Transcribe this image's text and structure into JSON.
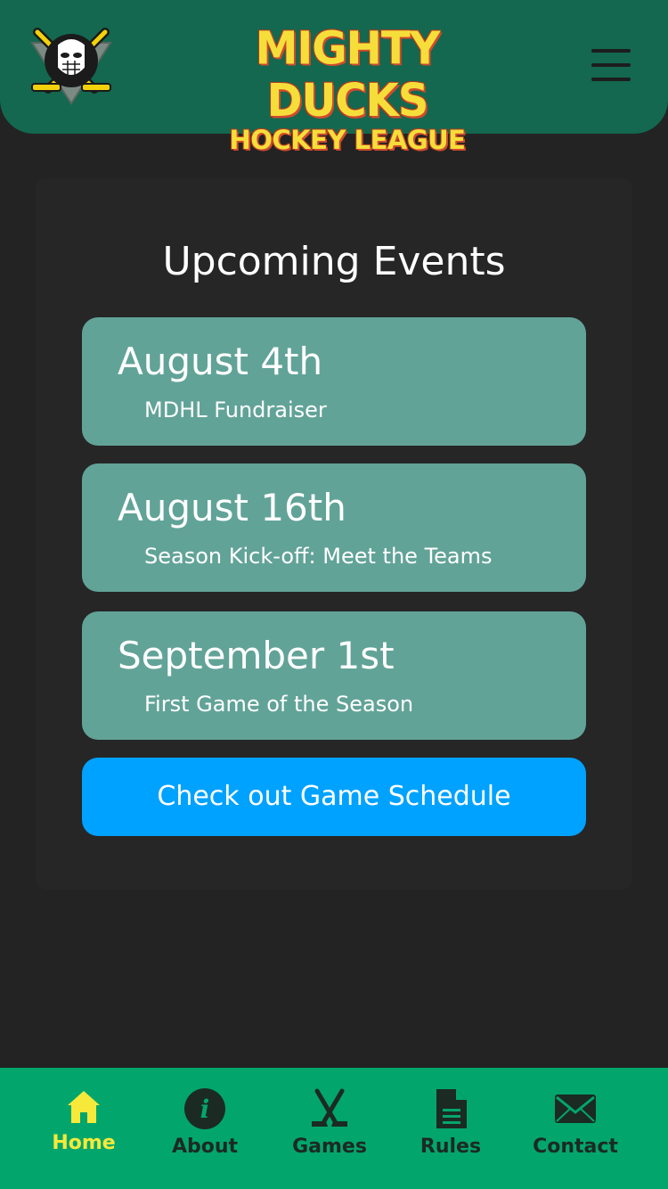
{
  "brand": {
    "line1": "MIGHTY DUCKS",
    "line2": "HOCKEY LEAGUE",
    "logo_icon": "goalie-mask-crossed-sticks-logo",
    "colors": {
      "header_bg": "#13684f",
      "brand_text": "#f6de3a",
      "brand_outline": "#d14a2d"
    }
  },
  "menu": {
    "icon": "hamburger-menu-icon"
  },
  "events_section": {
    "title": "Upcoming Events",
    "events": [
      {
        "date": "August 4th",
        "name": "MDHL Fundraiser"
      },
      {
        "date": "August 16th",
        "name": "Season Kick-off: Meet the Teams"
      },
      {
        "date": "September 1st",
        "name": "First Game of the Season"
      }
    ],
    "cta_label": "Check out Game Schedule",
    "colors": {
      "event_bg": "#62a398",
      "cta_bg": "#00a2ff"
    }
  },
  "bottom_nav": {
    "items": [
      {
        "label": "Home",
        "icon": "home-icon",
        "active": true
      },
      {
        "label": "About",
        "icon": "info-icon",
        "active": false
      },
      {
        "label": "Games",
        "icon": "hockey-sticks-icon",
        "active": false
      },
      {
        "label": "Rules",
        "icon": "document-icon",
        "active": false
      },
      {
        "label": "Contact",
        "icon": "envelope-icon",
        "active": false
      }
    ],
    "colors": {
      "bg": "#02a66c",
      "active": "#f6e93a",
      "inactive": "#1c2a24"
    }
  }
}
